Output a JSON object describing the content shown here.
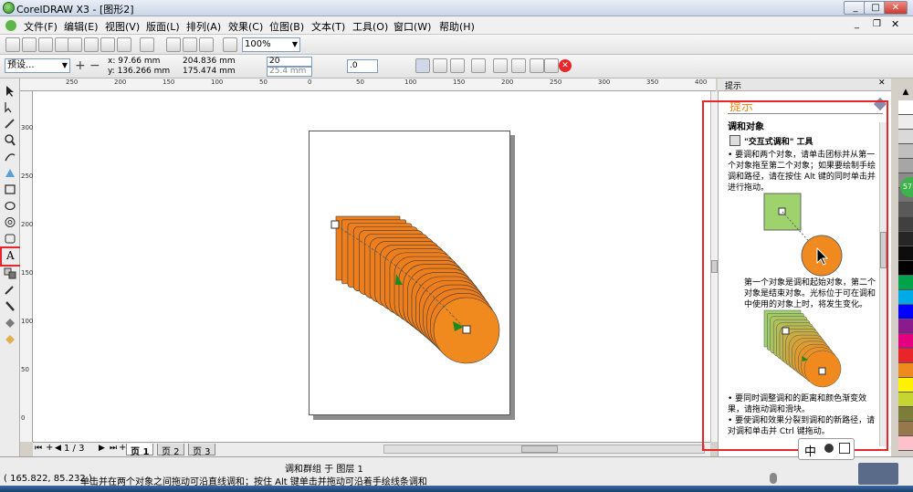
{
  "window": {
    "title": "CorelDRAW X3 - [图形2]",
    "controls": {
      "minimize": "_",
      "maximize": "□",
      "close": "✕"
    }
  },
  "menu": [
    "文件(F)",
    "编辑(E)",
    "视图(V)",
    "版面(L)",
    "排列(A)",
    "效果(C)",
    "位图(B)",
    "文本(T)",
    "工具(O)",
    "窗口(W)",
    "帮助(H)"
  ],
  "toolbar": {
    "zoom_value": "100%",
    "icons": [
      "new-icon",
      "open-icon",
      "save-icon",
      "print-icon",
      "cut-icon",
      "copy-icon",
      "paste-icon",
      "undo-icon",
      "redo-icon",
      "import-icon",
      "export-icon",
      "launcher-icon",
      "zoom-icon"
    ]
  },
  "property_bar": {
    "preset": "预设...",
    "x": "x: 97.66 mm",
    "y": "y: 136.266 mm",
    "width": "204.836 mm",
    "height": "175.474 mm",
    "steps": "20",
    "spacing": "25.4 mm",
    "rotation": ".0"
  },
  "rulers": {
    "top_ticks": [
      "250",
      "200",
      "150",
      "100",
      "50",
      "0",
      "50",
      "100",
      "150",
      "200",
      "250",
      "300",
      "350",
      "400"
    ],
    "left_ticks": [
      "300",
      "250",
      "200",
      "150",
      "100",
      "50",
      "0"
    ]
  },
  "page_nav": {
    "position": "1 / 3",
    "tabs": [
      "页 1",
      "页 2",
      "页 3"
    ]
  },
  "docker": {
    "title": "提示",
    "header": "提示",
    "section": "调和对象",
    "tool_name": "\"交互式调和\" 工具",
    "bullet1": "要调和两个对象，请单击团标并从第一个对象拖至第二个对象；如果要绘制手绘调和路径，请在按住 Alt 键的同时单击并进行拖动。",
    "caption": "第一个对象是调和起始对象，第二个对象是结束对象。光标位于可在调和中使用的对象上时，将发生变化。",
    "bullet2": "要同时调整调和的距离和颜色渐变效果，请拖动调和滑块。",
    "bullet3": "要使调和效果分裂到调和的新路径，请对调和单击并 Ctrl 键拖动。"
  },
  "status": {
    "object_info": "调和群组 于 图层 1",
    "coords": "( 165.822, 85.232 )",
    "hint": "单击并在两个对象之间拖动可沿直线调和；按住 Alt 键单击并拖动可沿着手绘线条调和"
  },
  "ime": {
    "label": "中"
  },
  "colors": {
    "blend_orange": "#ee7d1c",
    "hint_orange": "#f08a1e",
    "accent_red": "#e8262a",
    "demo_green": "#9dd26c"
  },
  "palette": [
    "#ffffff",
    "#ededed",
    "#d9d9d9",
    "#bfbfbf",
    "#a6a6a6",
    "#8c8c8c",
    "#737373",
    "#595959",
    "#404040",
    "#262626",
    "#0d0d0d",
    "#000000",
    "#00a24a",
    "#00a9e8",
    "#0000ff",
    "#8b1a8c",
    "#e4007f",
    "#e8262a",
    "#f08a1e",
    "#fff200",
    "#c7d531",
    "#7d7d3a",
    "#96784c",
    "#ffc0cb"
  ]
}
